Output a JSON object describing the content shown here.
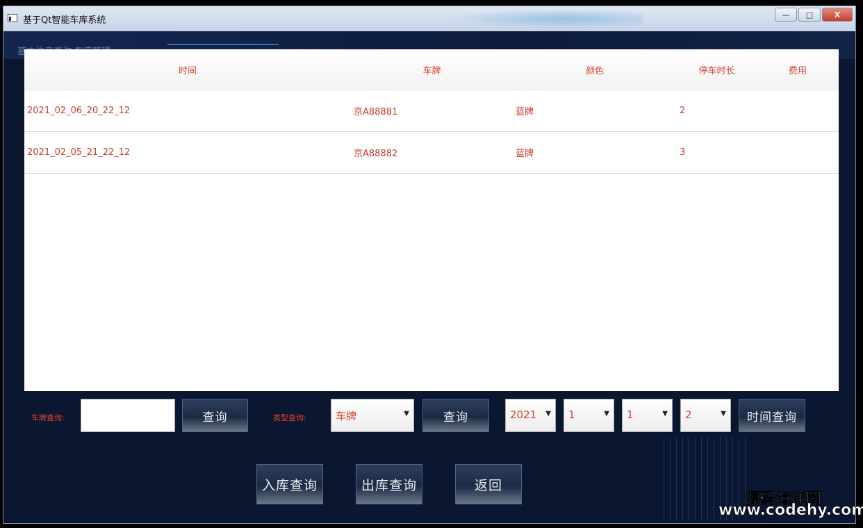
{
  "window": {
    "title": "基于Qt智能车库系统",
    "min_label": "—",
    "max_label": "□",
    "close_label": "X"
  },
  "background": {
    "ghost_text": "基本信息查询 车库管理"
  },
  "table": {
    "headers": [
      "时间",
      "车牌",
      "颜色",
      "停车时长",
      "费用"
    ],
    "rows": [
      [
        "2021_02_06_20_22_12",
        "京A88881",
        "蓝牌",
        "2",
        ""
      ],
      [
        "2021_02_05_21_22_12",
        "京A88882",
        "蓝牌",
        "3",
        ""
      ]
    ]
  },
  "controls": {
    "plate_label": "车牌查询:",
    "plate_value": "",
    "plate_query_button": "查询",
    "type_label": "类型查询:",
    "type_selected": "车牌",
    "type_query_button": "查询",
    "year_selected": "2021",
    "month_selected": "1",
    "day_selected": "1",
    "hour_selected": "2",
    "time_query_button": "时间查询"
  },
  "nav": {
    "in_query": "入库查询",
    "out_query": "出库查询",
    "back": "返回"
  },
  "watermark": {
    "line1": "源码海洋网",
    "line2": "www.codehy.com"
  }
}
